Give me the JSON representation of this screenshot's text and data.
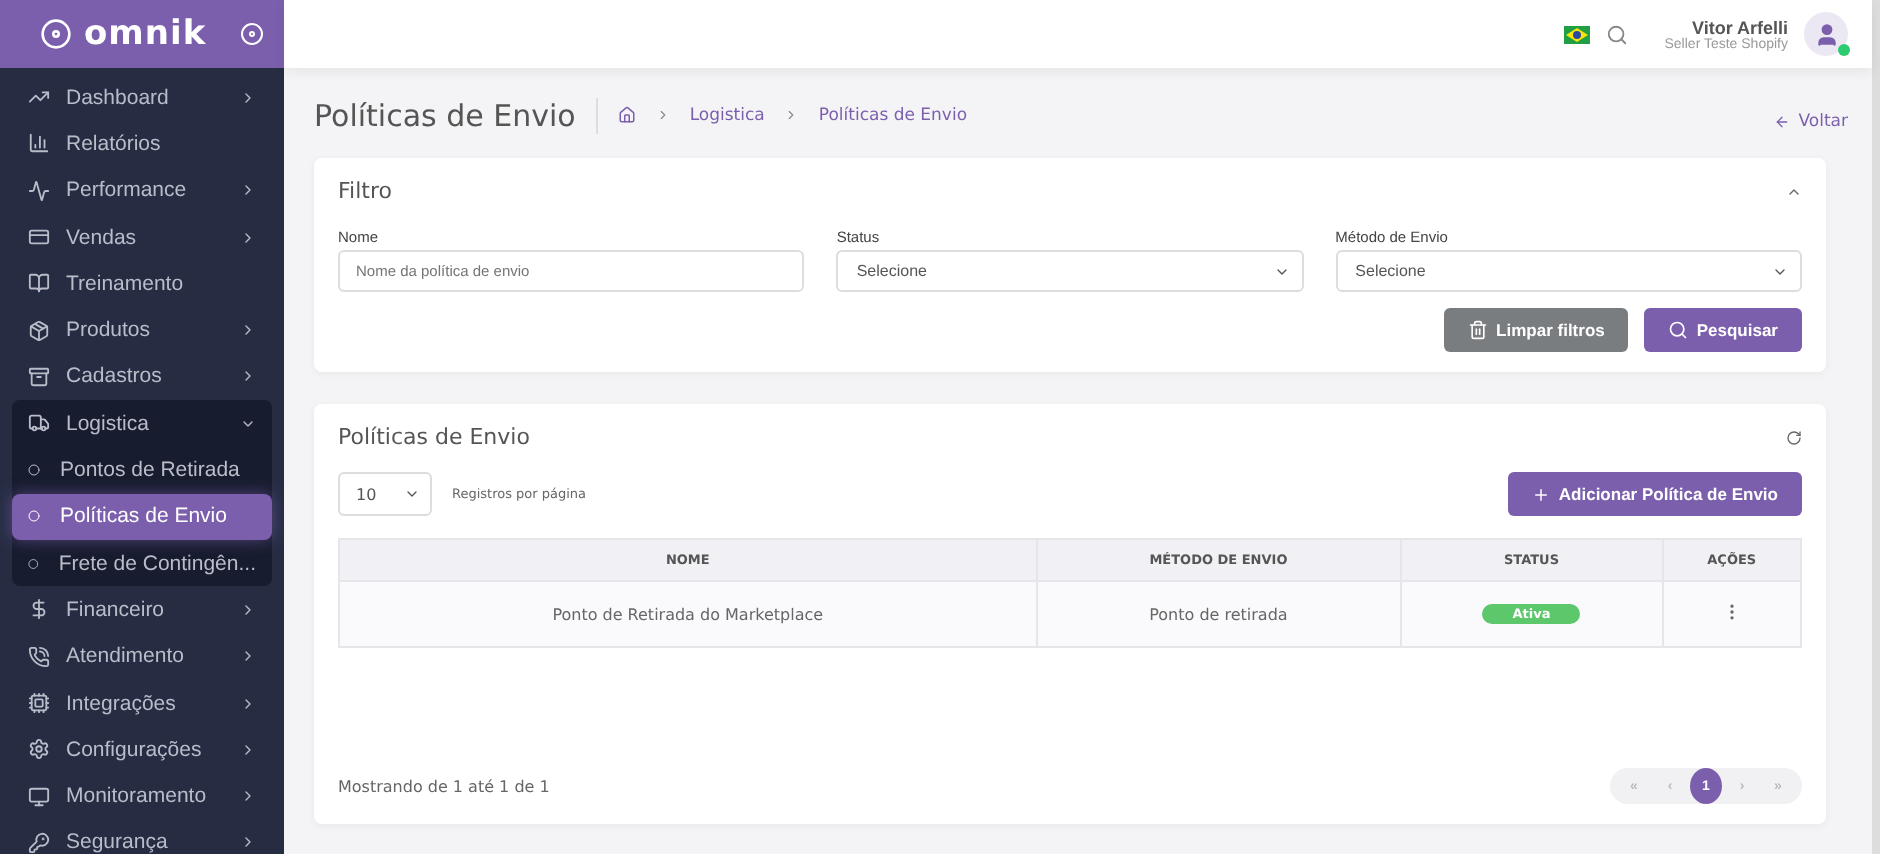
{
  "brand": {
    "name": "omnik"
  },
  "sidebar": {
    "items": [
      {
        "label": "Dashboard",
        "chevron": true,
        "expanded": false
      },
      {
        "label": "Relatórios",
        "chevron": false,
        "expanded": false
      },
      {
        "label": "Performance",
        "chevron": true,
        "expanded": false
      },
      {
        "label": "Vendas",
        "chevron": true,
        "expanded": false
      },
      {
        "label": "Treinamento",
        "chevron": false,
        "expanded": false
      },
      {
        "label": "Produtos",
        "chevron": true,
        "expanded": false
      },
      {
        "label": "Cadastros",
        "chevron": true,
        "expanded": false
      },
      {
        "label": "Logistica",
        "chevron": true,
        "expanded": true,
        "children": [
          {
            "label": "Pontos de Retirada",
            "selected": false
          },
          {
            "label": "Políticas de Envio",
            "selected": true
          },
          {
            "label": "Frete de Contingên...",
            "selected": false
          }
        ]
      },
      {
        "label": "Financeiro",
        "chevron": true,
        "expanded": false
      },
      {
        "label": "Atendimento",
        "chevron": true,
        "expanded": false
      },
      {
        "label": "Integrações",
        "chevron": true,
        "expanded": false
      },
      {
        "label": "Configurações",
        "chevron": true,
        "expanded": false
      },
      {
        "label": "Monitoramento",
        "chevron": true,
        "expanded": false
      },
      {
        "label": "Segurança",
        "chevron": true,
        "expanded": false
      }
    ]
  },
  "user": {
    "name": "Vitor Arfelli",
    "subtitle": "Seller Teste Shopify",
    "online": true
  },
  "page": {
    "title": "Políticas de Envio",
    "breadcrumb": [
      "Logistica",
      "Políticas de Envio"
    ],
    "back": "Voltar"
  },
  "filter": {
    "title": "Filtro",
    "fields": [
      {
        "kind": "text",
        "label": "Nome",
        "placeholder": "Nome da política de envio"
      },
      {
        "kind": "select",
        "label": "Status",
        "value": "Selecione"
      },
      {
        "kind": "select",
        "label": "Método de Envio",
        "value": "Selecione"
      }
    ],
    "clear_button": "Limpar filtros",
    "search_button": "Pesquisar"
  },
  "list": {
    "title": "Políticas de Envio",
    "page_size": "10",
    "page_size_label": "Registros por página",
    "add_button": "Adicionar Política de Envio",
    "columns": [
      "NOME",
      "MÉTODO DE ENVIO",
      "STATUS",
      "AÇÕES"
    ],
    "rows": [
      {
        "name": "Ponto de Retirada do Marketplace",
        "method": "Ponto de retirada",
        "status": "Ativa",
        "color": "#5cc76b"
      }
    ],
    "summary": "Mostrando de 1 até 1 de 1",
    "pagination": [
      {
        "label": "«",
        "selected": false
      },
      {
        "label": "‹",
        "selected": false
      },
      {
        "label": "1",
        "selected": true
      },
      {
        "label": "›",
        "selected": false
      },
      {
        "label": "»",
        "selected": false
      }
    ]
  }
}
